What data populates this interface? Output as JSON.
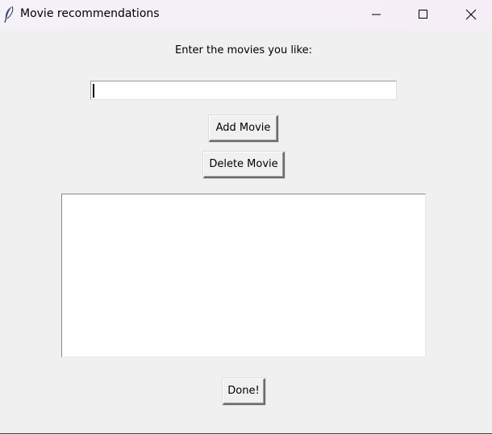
{
  "window": {
    "title": "Movie recommendations",
    "app_icon": "feather-icon",
    "controls": {
      "minimize_icon": "minimize-icon",
      "maximize_icon": "maximize-icon",
      "close_icon": "close-icon"
    }
  },
  "form": {
    "prompt": "Enter the movies you like:",
    "movie_input_value": "",
    "add_button": "Add Movie",
    "delete_button": "Delete Movie",
    "movie_list": [],
    "done_button": "Done!"
  }
}
